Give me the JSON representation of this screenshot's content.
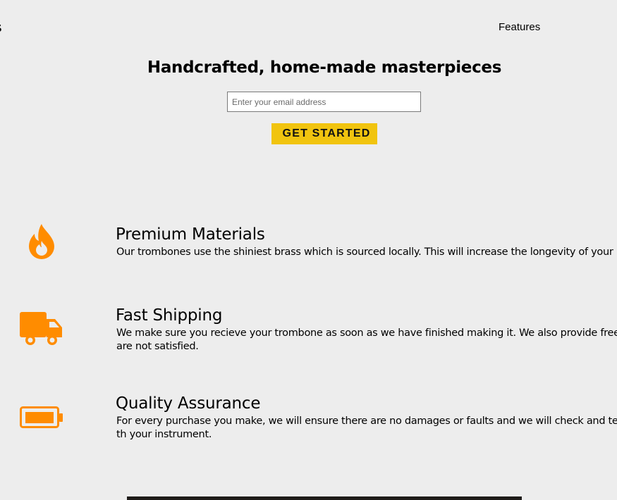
{
  "header": {
    "logo_fragment": "s",
    "nav": [
      {
        "label": "Features"
      }
    ]
  },
  "hero": {
    "title": "Handcrafted, home-made masterpieces",
    "email_placeholder": "Enter your email address",
    "cta_label": "GET STARTED"
  },
  "features": [
    {
      "icon": "fire-icon",
      "title": "Premium Materials",
      "description": "Our trombones use the shiniest brass which is sourced locally. This will increase the longevity of your pur"
    },
    {
      "icon": "truck-icon",
      "title": "Fast Shipping",
      "description": "We make sure you recieve your trombone as soon as we have finished making it. We also provide free ret are not satisfied."
    },
    {
      "icon": "battery-icon",
      "title": "Quality Assurance",
      "description": "For every purchase you make, we will ensure there are no damages or faults and we will check and test th your instrument."
    }
  ],
  "colors": {
    "background": "#ededed",
    "accent_icon": "#ff8c00",
    "cta_background": "#f1c40f"
  }
}
